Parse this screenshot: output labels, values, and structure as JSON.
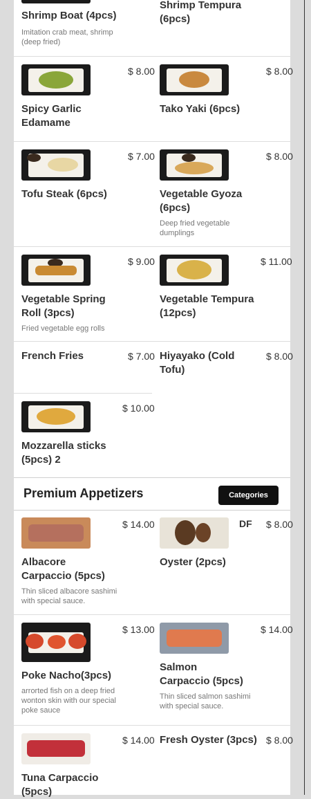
{
  "items": {
    "shrimp_boat": {
      "name": "Shrimp Boat (4pcs)",
      "desc": "Imitation crab meat, shrimp (deep fried)"
    },
    "shrimp_tempura": {
      "name": "Shrimp Tempura (6pcs)"
    },
    "spicy_garlic_edamame": {
      "name": "Spicy Garlic Edamame",
      "price": "$ 8.00"
    },
    "tako_yaki": {
      "name": "Tako Yaki (6pcs)",
      "price": "$ 8.00"
    },
    "tofu_steak": {
      "name": "Tofu Steak (6pcs)",
      "price": "$ 7.00"
    },
    "vegetable_gyoza": {
      "name": "Vegetable Gyoza (6pcs)",
      "price": "$ 8.00",
      "desc": "Deep fried vegetable dumplings"
    },
    "vegetable_spring_roll": {
      "name": "Vegetable Spring Roll (3pcs)",
      "price": "$ 9.00",
      "desc": "Fried vegetable egg rolls"
    },
    "vegetable_tempura": {
      "name": "Vegetable Tempura (12pcs)",
      "price": "$ 11.00"
    },
    "french_fries": {
      "name": "French Fries",
      "price": "$ 7.00"
    },
    "hiyayako": {
      "name": "Hiyayako (Cold Tofu)",
      "price": "$ 8.00"
    },
    "mozzarella_sticks": {
      "name": "Mozzarella sticks (5pcs) 2",
      "price": "$ 10.00"
    },
    "albacore_carpaccio": {
      "name": "Albacore Carpaccio (5pcs)",
      "price": "$ 14.00",
      "desc": "Thin sliced albacore sashimi with special sauce."
    },
    "oyster": {
      "name": "Oyster (2pcs)",
      "price": "$ 8.00",
      "badge": "DF"
    },
    "poke_nacho": {
      "name": "Poke Nacho(3pcs)",
      "price": "$ 13.00",
      "desc": "arrorted fish on a deep fried wonton skin with our special poke sauce"
    },
    "salmon_carpaccio": {
      "name": "Salmon Carpaccio (5pcs)",
      "price": "$ 14.00",
      "desc": "Thin sliced salmon sashimi with special sauce."
    },
    "tuna_carpaccio": {
      "name": "Tuna Carpaccio (5pcs)",
      "price": "$ 14.00"
    },
    "fresh_oyster": {
      "name": "Fresh Oyster (3pcs)",
      "price": "$ 8.00"
    }
  },
  "section": {
    "title": "Premium Appetizers",
    "categories_label": "Categories"
  },
  "icons": {
    "thumbnail": "food-photo"
  },
  "colors": {
    "background": "#dcdcdc",
    "panel": "#ffffff",
    "button": "#111111",
    "divider": "#dddddd"
  }
}
